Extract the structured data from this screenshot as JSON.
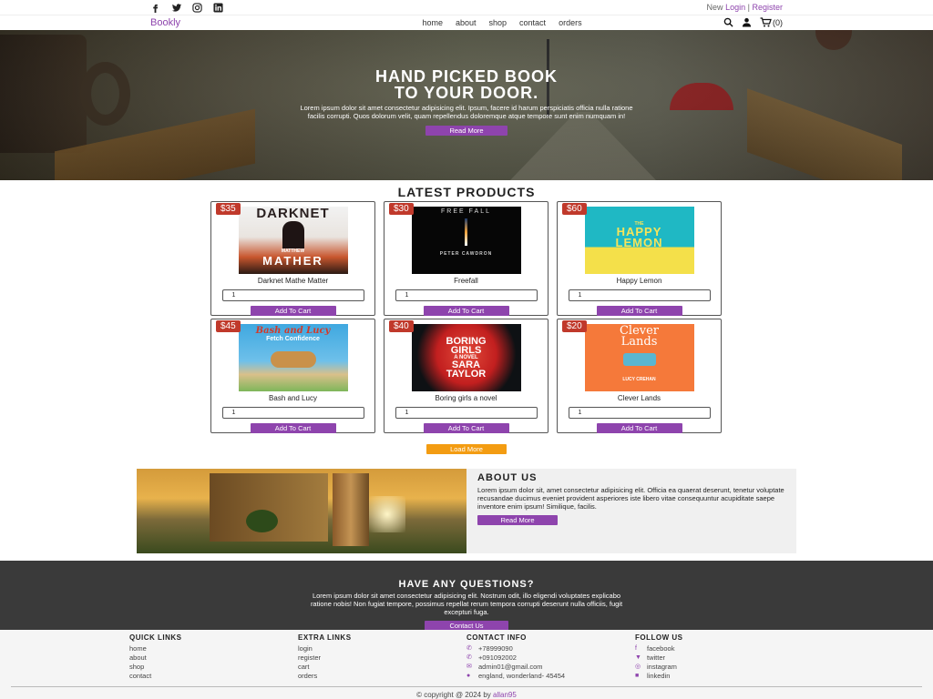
{
  "topbar": {
    "social": [
      "facebook-icon",
      "twitter-icon",
      "instagram-icon",
      "linkedin-icon"
    ],
    "auth_prefix": "New",
    "login": "Login",
    "separator": "|",
    "register": "Register"
  },
  "navbar": {
    "logo": "Bookly",
    "links": [
      "home",
      "about",
      "shop",
      "contact",
      "orders"
    ],
    "cart_count": "(0)"
  },
  "hero": {
    "title_line1": "HAND PICKED BOOK",
    "title_line2": "TO YOUR DOOR.",
    "text": "Lorem ipsum dolor sit amet consectetur adipisicing elit. Ipsum, facere id harum perspiciatis officia nulla ratione facilis corrupti. Quos dolorum velit, quam repellendus doloremque atque tempore sunt enim numquam in!",
    "button": "Read More"
  },
  "products": {
    "title": "LATEST PRODUCTS",
    "items": [
      {
        "price": "$35",
        "name": "Darknet Mathe Matter",
        "qty": "1",
        "button": "Add To Cart",
        "cover_top": "DARKNET",
        "cover_bottom": "MATHER",
        "cover_mid": "MATTHEW"
      },
      {
        "price": "$30",
        "name": "Freefall",
        "qty": "1",
        "button": "Add To Cart",
        "cover_top": "FREE FALL",
        "cover_bottom": "PETER CAWDRON"
      },
      {
        "price": "$60",
        "name": "Happy Lemon",
        "qty": "1",
        "button": "Add To Cart",
        "cover_top": "THE",
        "cover_mid": "HAPPY",
        "cover_bottom": "LEMON"
      },
      {
        "price": "$45",
        "name": "Bash and Lucy",
        "qty": "1",
        "button": "Add To Cart",
        "cover_top": "Bash and Lucy",
        "cover_mid": "Fetch Confidence"
      },
      {
        "price": "$40",
        "name": "Boring girls a novel",
        "qty": "1",
        "button": "Add To Cart",
        "cover_top": "BORING GIRLS",
        "cover_mid": "A NOVEL",
        "cover_bottom": "SARA TAYLOR"
      },
      {
        "price": "$20",
        "name": "Clever Lands",
        "qty": "1",
        "button": "Add To Cart",
        "cover_top": "Clever",
        "cover_mid": "Lands",
        "cover_bottom": "LUCY CREHAN"
      }
    ],
    "load_more": "Load More"
  },
  "about": {
    "title": "ABOUT US",
    "text": "Lorem ipsum dolor sit, amet consectetur adipisicing elit. Officia ea quaerat deserunt, tenetur voluptate recusandae ducimus eveniet provident asperiores iste libero vitae consequuntur acupiditate saepe inventore enim ipsum! Similique, facilis.",
    "button": "Read More"
  },
  "questions": {
    "title": "HAVE ANY QUESTIONS?",
    "text": "Lorem ipsum dolor sit amet consectetur adipisicing elit. Nostrum odit, illo eligendi voluptates explicabo ratione nobis! Non fugiat tempore, possimus repellat rerum tempora corrupti deserunt nulla officiis, fugit excepturi fuga.",
    "button": "Contact Us"
  },
  "footer": {
    "quick": {
      "title": "QUICK LINKS",
      "items": [
        "home",
        "about",
        "shop",
        "contact"
      ]
    },
    "extra": {
      "title": "EXTRA LINKS",
      "items": [
        "login",
        "register",
        "cart",
        "orders"
      ]
    },
    "contact": {
      "title": "CONTACT INFO",
      "items": [
        "+78999090",
        "+091092002",
        "admin01@gmail.com",
        "england, wonderland- 45454"
      ]
    },
    "follow": {
      "title": "FOLLOW US",
      "items": [
        "facebook",
        "twitter",
        "instagram",
        "linkedin"
      ]
    },
    "copy_prefix": "© copyright @ 2024 by",
    "copy_author": "allan95"
  },
  "colors": {
    "accent": "#8e44ad",
    "price": "#c0392b",
    "load_more": "#f39c12",
    "dark": "#3a3a3a"
  }
}
